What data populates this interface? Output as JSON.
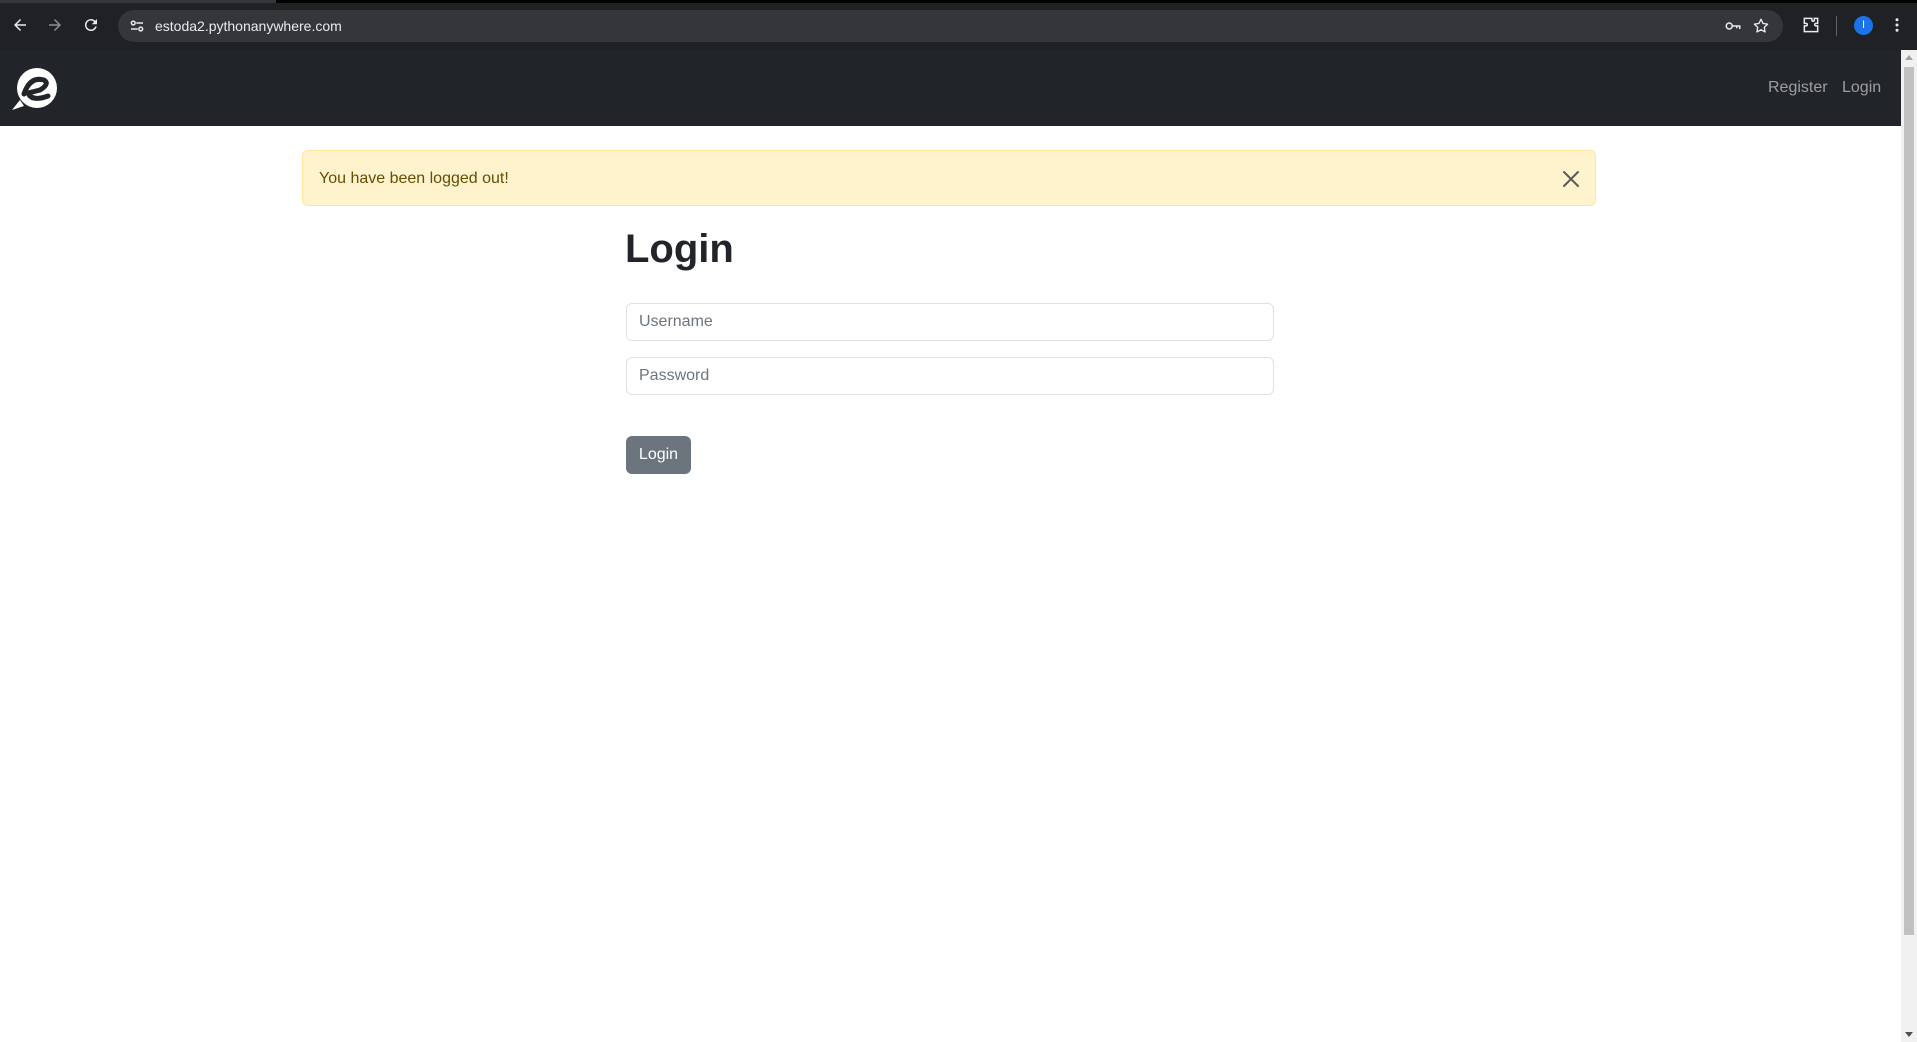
{
  "browser": {
    "url": "estoda2.pythonanywhere.com",
    "profile_initial": "I"
  },
  "navbar": {
    "register_label": "Register",
    "login_label": "Login"
  },
  "alert": {
    "message": "You have been logged out!"
  },
  "form": {
    "title": "Login",
    "username_placeholder": "Username",
    "password_placeholder": "Password",
    "submit_label": "Login"
  },
  "colors": {
    "navbar_bg": "#212529",
    "alert_bg": "#fff3cd",
    "alert_text": "#664d03",
    "button_bg": "#6c757d"
  }
}
